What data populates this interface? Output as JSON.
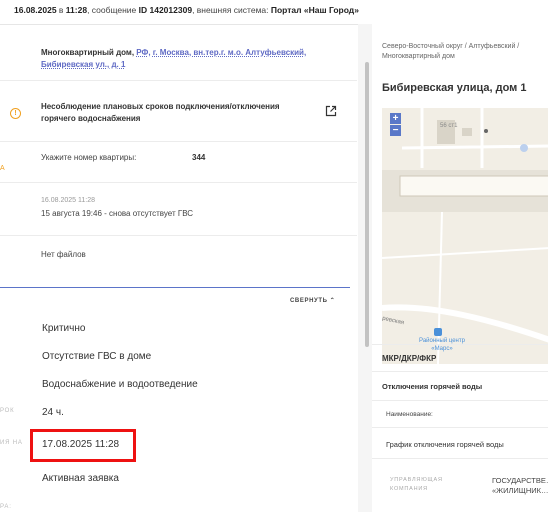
{
  "header": {
    "date": "16.08.2025",
    "time_prefix": " в ",
    "time": "11:28",
    "msg_prefix": ", сообщение ",
    "msg_id": "ID 142012309",
    "system_prefix": ", внешняя система: ",
    "system": "Портал «Наш Город»"
  },
  "address": {
    "plain": "Многоквартирный дом, ",
    "link": "РФ, г. Москва, вн.тер.г. м.о. Алтуфьевский, Бибиревская ул., д. 1"
  },
  "subject": "Несоблюдение плановых сроков подключения/отключения горячего водоснабжения",
  "apartment": {
    "label": "Укажите номер квартиры:",
    "value": "344"
  },
  "comment": {
    "date": "16.08.2025 11:28",
    "text": "15 августа 19:46 - снова отсутствует ГВС"
  },
  "files": {
    "empty": "Нет файлов"
  },
  "collapse_label": "СВЕРНУТЬ",
  "details": [
    {
      "label": "",
      "value": "Критично"
    },
    {
      "label": "",
      "value": "Отсутствие ГВС в доме"
    },
    {
      "label": "",
      "value": "Водоснабжение и водоотведение"
    },
    {
      "label": "РОК",
      "value": "24 ч."
    },
    {
      "label": "ИЯ НА",
      "value": "17.08.2025 11:28"
    },
    {
      "label": "",
      "value": "Активная заявка"
    },
    {
      "label": "РА:",
      "value": ""
    }
  ],
  "right": {
    "breadcrumb": "Северо-Восточный округ / Алтуфьевский / Многоквартирный дом",
    "title": "Бибиревская улица, дом 1",
    "map": {
      "zoom_in": "+",
      "zoom_out": "−",
      "building_label": "56 ст1",
      "street": "ревская",
      "center": "Районный центр «Марс»"
    },
    "mkr": "МКР/ДКР/ФКР",
    "outages_title": "Отключения горячей воды",
    "name_label": "Наименование:",
    "schedule": "График отключения горячей воды",
    "management_label": "УПРАВЛЯЮЩАЯ КОМПАНИЯ",
    "management_value": "ГОСУДАРСТВЕ… «ЖИЛИЩНИК…"
  }
}
